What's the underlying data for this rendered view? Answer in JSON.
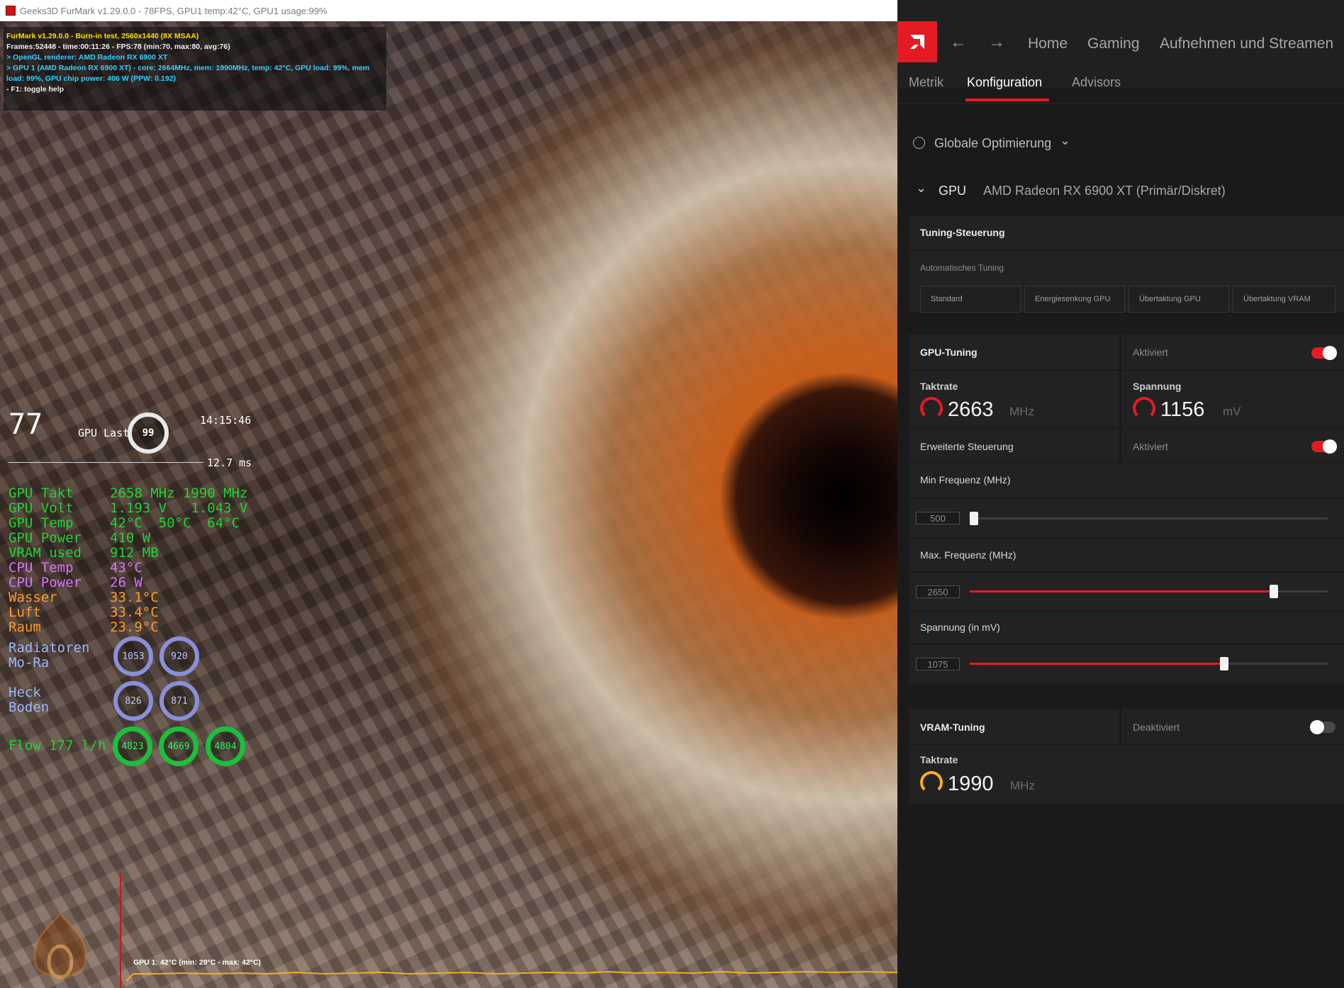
{
  "furmark": {
    "window_title": "Geeks3D FurMark v1.29.0.0 - 78FPS, GPU1 temp:42°C, GPU1 usage:99%",
    "info_lines": [
      "FurMark v1.29.0.0 - Burn-in test, 2560x1440 (8X MSAA)",
      "Frames:52448 - time:00:11:26 - FPS:78 (min:70, max:80, avg:76)",
      "> OpenGL renderer: AMD Radeon RX 6900 XT",
      "> GPU 1 (AMD Radeon RX 6900 XT) - core: 2664MHz, mem: 1990MHz, temp: 42°C, GPU load: 99%, mem load: 99%, GPU chip power: 406 W (PPW: 0.192)",
      "- F1: toggle help"
    ],
    "graph_label": "GPU 1: 42°C (min: 29°C - max: 42°C)"
  },
  "overlay": {
    "fps": "77",
    "gpu_last_label": "GPU Last",
    "gpu_last_value": "99",
    "clock": "14:15:46",
    "frametime": "12.7 ms",
    "stats": [
      {
        "key": "GPU Takt",
        "value": "2658 MHz 1990 MHz",
        "color": "#1fd23a"
      },
      {
        "key": "GPU Volt",
        "value": "1.193 V   1.043 V",
        "color": "#1fd23a"
      },
      {
        "key": "GPU Temp",
        "value": "42°C  50°C  64°C",
        "color": "#1fd23a"
      },
      {
        "key": "GPU Power",
        "value": "410 W",
        "color": "#1fd23a"
      },
      {
        "key": "VRAM used",
        "value": "912 MB",
        "color": "#1fd23a"
      },
      {
        "key": "CPU Temp",
        "value": "43°C",
        "color": "#d774ff"
      },
      {
        "key": "CPU Power",
        "value": "26 W",
        "color": "#d774ff"
      },
      {
        "key": "Wasser",
        "value": "33.1°C",
        "color": "#ff9a2a"
      },
      {
        "key": "Luft",
        "value": "33.4°C",
        "color": "#ff9a2a"
      },
      {
        "key": "Raum",
        "value": "23.9°C",
        "color": "#ff9a2a"
      }
    ],
    "radiatoren": {
      "label1": "Radiatoren",
      "label2": "Mo-Ra",
      "v1": "1053",
      "v2": "920"
    },
    "heck": {
      "label1": "Heck",
      "label2": "Boden",
      "v1": "826",
      "v2": "871"
    },
    "flow": {
      "label": "Flow 177 l/h",
      "v1": "4823",
      "v2": "4669",
      "v3": "4804"
    }
  },
  "amd": {
    "nav": {
      "back": "←",
      "forward": "→",
      "home": "Home",
      "gaming": "Gaming",
      "stream": "Aufnehmen und Streamen"
    },
    "subtabs": {
      "metrik": "Metrik",
      "konfiguration": "Konfiguration",
      "advisors": "Advisors"
    },
    "global_opt": "Globale Optimierung",
    "gpu_label": "GPU",
    "gpu_name": "AMD Radeon RX 6900 XT (Primär/Diskret)",
    "tuning": {
      "title": "Tuning-Steuerung",
      "auto_label": "Automatisches Tuning",
      "buttons": [
        "Standard",
        "Energiesenkung GPU",
        "Übertaktung GPU",
        "Übertaktung VRAM"
      ]
    },
    "gpu_tuning": {
      "title": "GPU-Tuning",
      "state": "Aktiviert",
      "enabled": true,
      "takt_label": "Taktrate",
      "takt_value": "2663",
      "takt_unit": "MHz",
      "spannung_label": "Spannung",
      "spannung_value": "1156",
      "spannung_unit": "mV",
      "erweitert_label": "Erweiterte Steuerung",
      "erweitert_state": "Aktiviert",
      "min_label": "Min Frequenz (MHz)",
      "min_value": "500",
      "min_fraction": 0.0,
      "max_label": "Max. Frequenz (MHz)",
      "max_value": "2650",
      "max_fraction": 0.85,
      "volt_label": "Spannung (in mV)",
      "volt_value": "1075",
      "volt_fraction": 0.71
    },
    "vram_tuning": {
      "title": "VRAM-Tuning",
      "state": "Deaktiviert",
      "enabled": false,
      "takt_label": "Taktrate",
      "takt_value": "1990",
      "takt_unit": "MHz"
    },
    "colors": {
      "accent": "#e51b23",
      "vram_gauge": "#f5b21b"
    }
  }
}
